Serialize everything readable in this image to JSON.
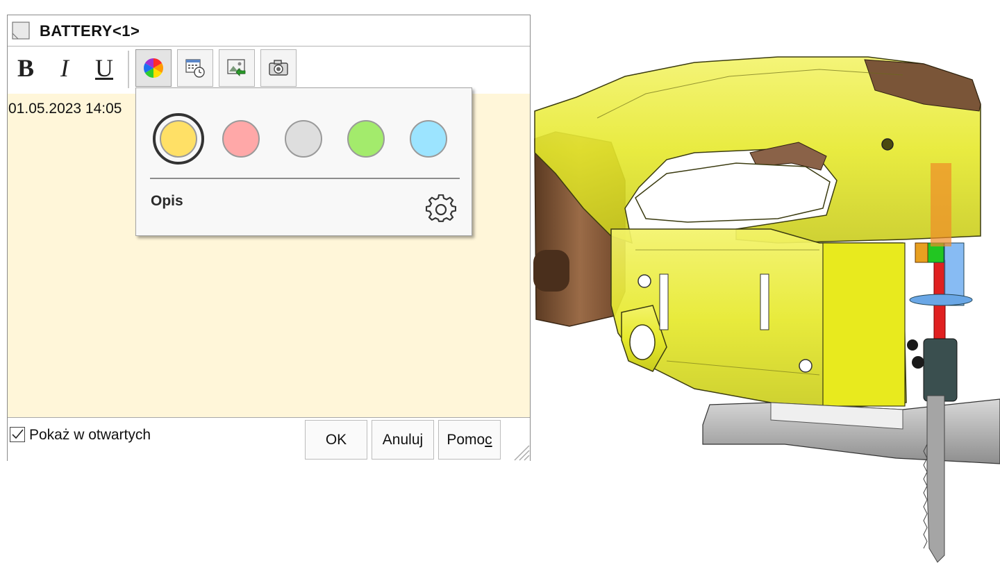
{
  "dialog": {
    "title": "BATTERY<1>",
    "toolbar": {
      "bold_label": "B",
      "italic_label": "I",
      "underline_label": "U",
      "buttons": [
        "color-wheel-icon",
        "calendar-clock-icon",
        "insert-image-icon",
        "camera-icon"
      ]
    },
    "note_text": "01.05.2023 14:05",
    "note_background": "#fff6d9",
    "footer": {
      "checkbox_label": "Pokaż w otwartych",
      "checkbox_checked": true,
      "ok_label": "OK",
      "cancel_label": "Anuluj",
      "help_label_prefix": "Pomo",
      "help_label_mnemonic": "c"
    }
  },
  "color_popup": {
    "swatches": [
      {
        "color": "#ffe066",
        "selected": true
      },
      {
        "color": "#ffa8a8",
        "selected": false
      },
      {
        "color": "#dedede",
        "selected": false
      },
      {
        "color": "#a3eb6c",
        "selected": false
      },
      {
        "color": "#9ce4ff",
        "selected": false
      }
    ],
    "label": "Opis",
    "settings_icon": "gear-icon"
  },
  "model_view": {
    "colors": {
      "housing": "#e9ec2c",
      "battery": "#8a5a3a",
      "base_plate": "#a5a5a5",
      "blade": "#999999",
      "rod": "#e52020"
    }
  }
}
